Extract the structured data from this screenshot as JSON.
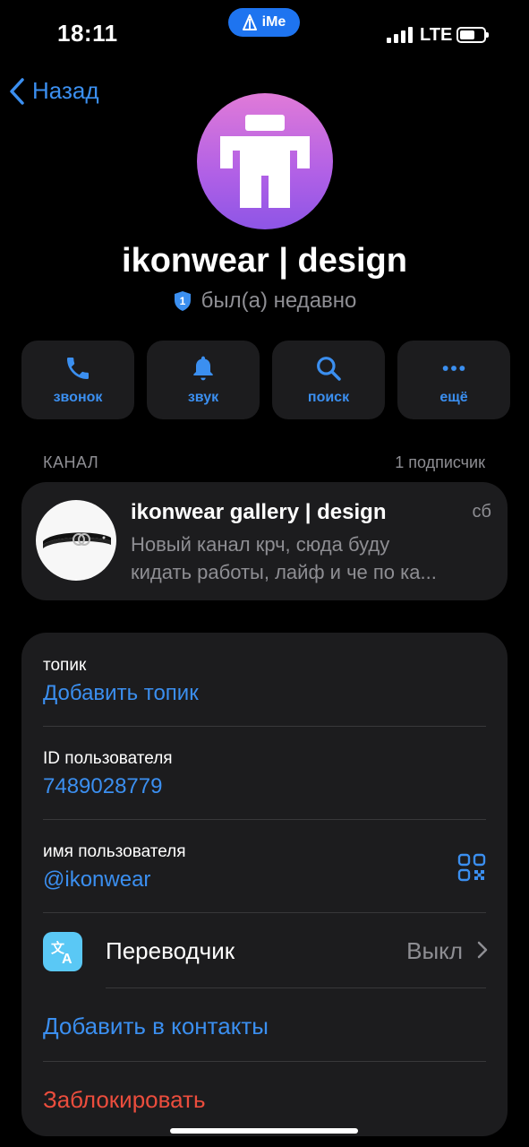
{
  "status_bar": {
    "time": "18:11",
    "app_badge": "iMe",
    "network": "LTE"
  },
  "nav": {
    "back_label": "Назад"
  },
  "profile": {
    "name": "ikonwear | design",
    "verified_badge": "1",
    "last_seen": "был(а) недавно"
  },
  "actions": [
    {
      "icon": "phone-icon",
      "label": "звонок"
    },
    {
      "icon": "bell-icon",
      "label": "звук"
    },
    {
      "icon": "search-icon",
      "label": "поиск"
    },
    {
      "icon": "more-icon",
      "label": "ещё"
    }
  ],
  "channel": {
    "section_label": "КАНАЛ",
    "subscribers": "1 подписчик",
    "title": "ikonwear gallery | design",
    "day": "сб",
    "preview_line1": "Новый канал крч, сюда буду",
    "preview_line2": "кидать работы, лайф и че по ка..."
  },
  "info": {
    "topic_label": "топик",
    "topic_value": "Добавить топик",
    "id_label": "ID пользователя",
    "id_value": "7489028779",
    "username_label": "имя пользователя",
    "username_value": "@ikonwear",
    "translator_label": "Переводчик",
    "translator_value": "Выкл",
    "add_contact": "Добавить в контакты",
    "block": "Заблокировать"
  },
  "colors": {
    "accent": "#3b8ff0",
    "danger": "#eb4d3d",
    "card": "#1c1c1e"
  }
}
